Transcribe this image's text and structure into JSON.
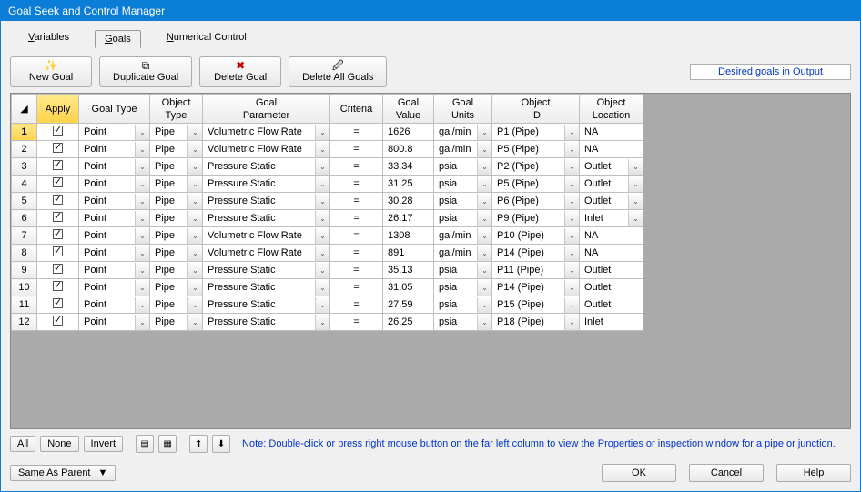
{
  "title": "Goal Seek and Control Manager",
  "tabs": [
    "ariables",
    "oals",
    "umerical Control"
  ],
  "toolbar": {
    "new": "New Goal",
    "dup": "Duplicate Goal",
    "del": "Delete Goal",
    "delall": "Delete All Goals",
    "output": "Desired goals in Output"
  },
  "cols": {
    "0": "Apply",
    "1": "Goal Type",
    "2a": "Object",
    "2b": "Type",
    "3a": "Goal",
    "3b": "Parameter",
    "4": "Criteria",
    "5a": "Goal",
    "5b": "Value",
    "6a": "Goal",
    "6b": "Units",
    "7a": "Object",
    "7b": "ID",
    "8a": "Object",
    "8b": "Location"
  },
  "rows": [
    {
      "n": "1",
      "sel": true,
      "apply": true,
      "gtype": "Point",
      "otype": "Pipe",
      "gparam": "Volumetric Flow Rate",
      "crit": "=",
      "gval": "1626",
      "gunits": "gal/min",
      "oid": "P1   (Pipe)",
      "oloc": "NA",
      "locdd": false
    },
    {
      "n": "2",
      "apply": true,
      "gtype": "Point",
      "otype": "Pipe",
      "gparam": "Volumetric Flow Rate",
      "crit": "=",
      "gval": "800.8",
      "gunits": "gal/min",
      "oid": "P5   (Pipe)",
      "oloc": "NA",
      "locdd": false
    },
    {
      "n": "3",
      "apply": true,
      "gtype": "Point",
      "otype": "Pipe",
      "gparam": "Pressure Static",
      "crit": "=",
      "gval": "33.34",
      "gunits": "psia",
      "oid": "P2   (Pipe)",
      "oloc": "Outlet",
      "locdd": true
    },
    {
      "n": "4",
      "apply": true,
      "gtype": "Point",
      "otype": "Pipe",
      "gparam": "Pressure Static",
      "crit": "=",
      "gval": "31.25",
      "gunits": "psia",
      "oid": "P5   (Pipe)",
      "oloc": "Outlet",
      "locdd": true
    },
    {
      "n": "5",
      "apply": true,
      "gtype": "Point",
      "otype": "Pipe",
      "gparam": "Pressure Static",
      "crit": "=",
      "gval": "30.28",
      "gunits": "psia",
      "oid": "P6   (Pipe)",
      "oloc": "Outlet",
      "locdd": true
    },
    {
      "n": "6",
      "apply": true,
      "gtype": "Point",
      "otype": "Pipe",
      "gparam": "Pressure Static",
      "crit": "=",
      "gval": "26.17",
      "gunits": "psia",
      "oid": "P9   (Pipe)",
      "oloc": "Inlet",
      "locdd": true
    },
    {
      "n": "7",
      "apply": true,
      "gtype": "Point",
      "otype": "Pipe",
      "gparam": "Volumetric Flow Rate",
      "crit": "=",
      "gval": "1308",
      "gunits": "gal/min",
      "oid": "P10  (Pipe)",
      "oloc": "NA",
      "locdd": false
    },
    {
      "n": "8",
      "apply": true,
      "gtype": "Point",
      "otype": "Pipe",
      "gparam": "Volumetric Flow Rate",
      "crit": "=",
      "gval": "891",
      "gunits": "gal/min",
      "oid": "P14  (Pipe)",
      "oloc": "NA",
      "locdd": false
    },
    {
      "n": "9",
      "apply": true,
      "gtype": "Point",
      "otype": "Pipe",
      "gparam": "Pressure Static",
      "crit": "=",
      "gval": "35.13",
      "gunits": "psia",
      "oid": "P11  (Pipe)",
      "oloc": "Outlet",
      "locdd": false
    },
    {
      "n": "10",
      "apply": true,
      "gtype": "Point",
      "otype": "Pipe",
      "gparam": "Pressure Static",
      "crit": "=",
      "gval": "31.05",
      "gunits": "psia",
      "oid": "P14  (Pipe)",
      "oloc": "Outlet",
      "locdd": false
    },
    {
      "n": "11",
      "apply": true,
      "gtype": "Point",
      "otype": "Pipe",
      "gparam": "Pressure Static",
      "crit": "=",
      "gval": "27.59",
      "gunits": "psia",
      "oid": "P15  (Pipe)",
      "oloc": "Outlet",
      "locdd": false
    },
    {
      "n": "12",
      "apply": true,
      "gtype": "Point",
      "otype": "Pipe",
      "gparam": "Pressure Static",
      "crit": "=",
      "gval": "26.25",
      "gunits": "psia",
      "oid": "P18  (Pipe)",
      "oloc": "Inlet",
      "locdd": false
    }
  ],
  "footer": {
    "all": "All",
    "none": "None",
    "invert": "Invert",
    "note": "Note: Double-click or press right mouse button on the far left column to view the Properties or inspection window for a pipe or junction."
  },
  "bottom": {
    "combo": "Same As Parent",
    "ok": "OK",
    "cancel": "Cancel",
    "help": "Help"
  }
}
